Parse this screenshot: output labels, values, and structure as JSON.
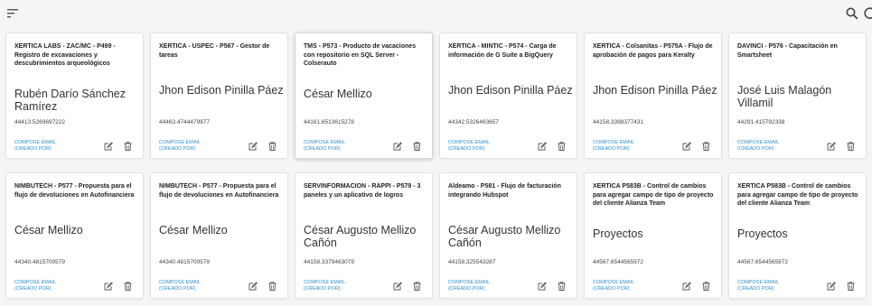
{
  "header": {
    "menu_icon": "sort-menu-icon",
    "search_icon": "search-icon",
    "refresh_icon": "refresh-icon"
  },
  "colors": {
    "background": "#f4f5f7",
    "card": "#ffffff",
    "link": "#2b8fd6",
    "text": "#333333"
  },
  "cards": [
    {
      "title": "XERTICA LABS - ZAC/MC - P499 - Registro de excavaciones y descubrimientos arqueológicos",
      "name": "Rubén Darío Sánchez Ramírez",
      "id": "44413.5269697222",
      "action_line1": "Compose Email",
      "action_line2": "(Creado por)"
    },
    {
      "title": "XERTICA - USPEC - P567 - Gestor de tareas",
      "name": "Jhon Edison Pinilla Páez",
      "id": "44463.4744479977",
      "action_line1": "Compose Email",
      "action_line2": "(Creado por)"
    },
    {
      "title": "TMS - P573 - Producto de vacaciones con repositorio en SQL Server - Colserauto",
      "name": "César Mellizo",
      "id": "44161.6513615278",
      "action_line1": "Compose Email",
      "action_line2": "(Creado por)"
    },
    {
      "title": "XERTICA - MINTIC - P574 - Carga de información de G Suite a BigQuery",
      "name": "Jhon Edison Pinilla Páez",
      "id": "44342.5326463657",
      "action_line1": "Compose Email",
      "action_line2": "(Creado por)"
    },
    {
      "title": "XERTICA - Colsanitas - P575A - Flujo de aprobación de pagos para Keralty",
      "name": "Jhon Edison Pinilla Páez",
      "id": "44158.3398377431",
      "action_line1": "Compose Email",
      "action_line2": "(Creado por)"
    },
    {
      "title": "DAVINCI - P576 - Capacitación en Smartsheet",
      "name": "José Luis Malagón Villamil",
      "id": "44291.415792338",
      "action_line1": "Compose Email",
      "action_line2": "(Creado por)"
    },
    {
      "title": "NIMBUTECH - P577 - Propuesta para el flujo de devoluciones en Autofinanciera",
      "name": "César Mellizo",
      "id": "44340.4815700579",
      "action_line1": "Compose Email",
      "action_line2": "(Creado por)"
    },
    {
      "title": "NIMBUTECH - P577 - Propuesta para el flujo de devoluciones en Autofinanciera",
      "name": "César Mellizo",
      "id": "44340.4815700579",
      "action_line1": "Compose Email",
      "action_line2": "(Creado por)"
    },
    {
      "title": "SERVINFORMACION - RAPPI - P579 - 3 paneles y un aplicativo de logros",
      "name": "César Augusto Mellizo Cañón",
      "id": "44158.3379463079",
      "action_line1": "Compose Email",
      "action_line2": "(Creado por)"
    },
    {
      "title": "Aldeamo - P581 - Flujo de facturación integrando Hubspot",
      "name": "César Augusto Mellizo Cañón",
      "id": "44158.325543287",
      "action_line1": "Compose Email",
      "action_line2": "(Creado por)"
    },
    {
      "title": "XERTICA P583B - Control de cambios para agregar campo de tipo de proyecto del cliente Alianza Team",
      "name": "Proyectos",
      "id": "44567.6544565972",
      "action_line1": "Compose Email",
      "action_line2": "(Creado por)"
    },
    {
      "title": "XERTICA P583B - Control de cambios para agregar campo de tipo de proyecto del cliente Alianza Team",
      "name": "Proyectos",
      "id": "44567.6544565972",
      "action_line1": "Compose Email",
      "action_line2": "(Creado por)"
    }
  ]
}
